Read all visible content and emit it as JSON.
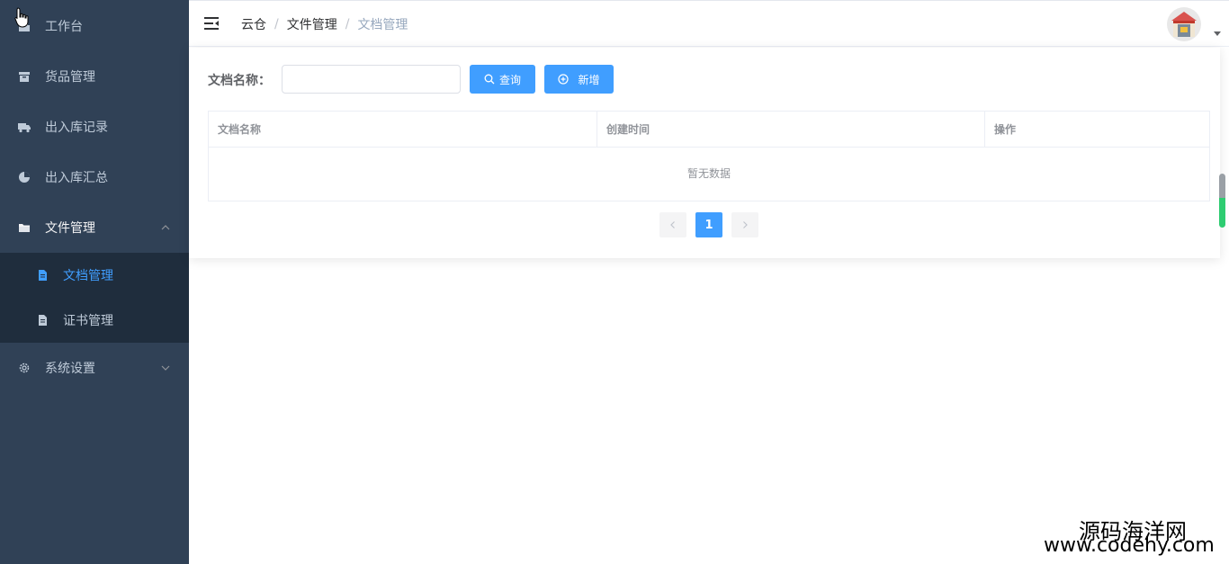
{
  "sidebar": {
    "items": [
      {
        "label": "工作台",
        "icon": "dashboard-icon"
      },
      {
        "label": "货品管理",
        "icon": "box-icon"
      },
      {
        "label": "出入库记录",
        "icon": "truck-icon"
      },
      {
        "label": "出入库汇总",
        "icon": "pie-chart-icon"
      },
      {
        "label": "文件管理",
        "icon": "folder-icon",
        "expanded": true
      },
      {
        "label": "系统设置",
        "icon": "gear-icon"
      }
    ],
    "submenu": [
      {
        "label": "文档管理",
        "icon": "document-icon",
        "active": true
      },
      {
        "label": "证书管理",
        "icon": "document-icon"
      }
    ]
  },
  "header": {
    "breadcrumb": [
      "云仓",
      "文件管理",
      "文档管理"
    ],
    "separator": "/"
  },
  "search": {
    "label": "文档名称：",
    "value": "",
    "query_label": "查询",
    "add_label": "新增"
  },
  "table": {
    "columns": [
      "文档名称",
      "创建时间",
      "操作"
    ],
    "empty_text": "暂无数据",
    "rows": []
  },
  "pagination": {
    "current_page": "1"
  },
  "watermark": {
    "line1": "源码海洋网",
    "line2": "www.codehy.com"
  },
  "colors": {
    "sidebar_bg": "#304156",
    "submenu_bg": "#1f2d3d",
    "primary": "#409eff"
  }
}
